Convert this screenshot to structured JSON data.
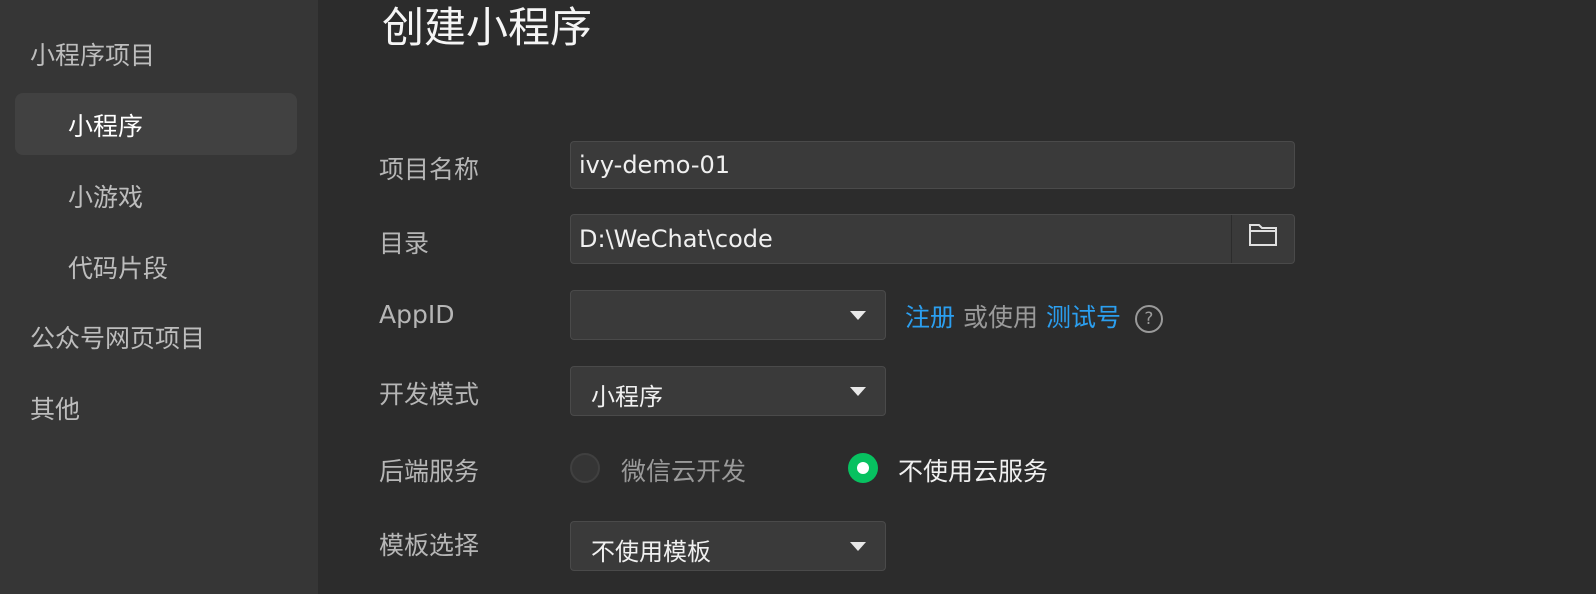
{
  "sidebar": {
    "sections": [
      {
        "label": "小程序项目"
      },
      {
        "label": "公众号网页项目"
      },
      {
        "label": "其他"
      }
    ],
    "items": [
      {
        "label": "小程序",
        "active": true
      },
      {
        "label": "小游戏",
        "active": false
      },
      {
        "label": "代码片段",
        "active": false
      }
    ]
  },
  "main": {
    "title": "创建小程序",
    "form": {
      "project_name": {
        "label": "项目名称",
        "value": "ivy-demo-01"
      },
      "directory": {
        "label": "目录",
        "value": "D:\\WeChat\\code",
        "icon": "folder-icon"
      },
      "appid": {
        "label": "AppID",
        "value": "",
        "register_link": "注册",
        "or_use_text": "或使用",
        "test_account_link": "测试号",
        "help_icon": "?"
      },
      "dev_mode": {
        "label": "开发模式",
        "value": "小程序"
      },
      "backend": {
        "label": "后端服务",
        "options": [
          {
            "label": "微信云开发",
            "selected": false
          },
          {
            "label": "不使用云服务",
            "selected": true
          }
        ]
      },
      "template": {
        "label": "模板选择",
        "value": "不使用模板"
      }
    }
  },
  "colors": {
    "accent_green": "#07c160",
    "link_blue": "#2b9ff0",
    "background": "#2c2c2c",
    "sidebar": "#363636"
  }
}
